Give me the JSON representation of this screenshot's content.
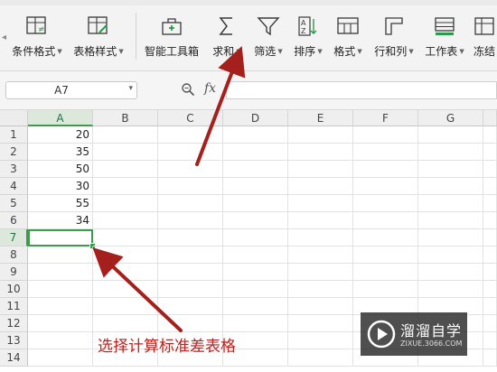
{
  "ribbon": {
    "left_scroll_icon": "chevron-left-icon",
    "buttons": [
      {
        "id": "conditional-format",
        "label": "条件格式",
        "has_dropdown": true,
        "icon": "conditional-format-icon"
      },
      {
        "id": "table-style",
        "label": "表格样式",
        "has_dropdown": true,
        "icon": "table-style-icon"
      },
      {
        "id": "smart-toolbox",
        "label": "智能工具箱",
        "has_dropdown": false,
        "icon": "toolbox-icon"
      },
      {
        "id": "sum",
        "label": "求和",
        "has_dropdown": true,
        "icon": "sigma-icon"
      },
      {
        "id": "filter",
        "label": "筛选",
        "has_dropdown": true,
        "icon": "filter-icon"
      },
      {
        "id": "sort",
        "label": "排序",
        "has_dropdown": true,
        "icon": "sort-az-icon"
      },
      {
        "id": "format",
        "label": "格式",
        "has_dropdown": true,
        "icon": "format-icon"
      },
      {
        "id": "rows-cols",
        "label": "行和列",
        "has_dropdown": true,
        "icon": "rows-cols-icon"
      },
      {
        "id": "worksheet",
        "label": "工作表",
        "has_dropdown": true,
        "icon": "worksheet-icon"
      },
      {
        "id": "freeze",
        "label": "冻结",
        "has_dropdown": false,
        "icon": "freeze-icon"
      }
    ]
  },
  "formula_bar": {
    "name_box": "A7",
    "zoom_icon": "zoom-icon",
    "fx_label": "fx",
    "formula": ""
  },
  "sheet": {
    "columns": [
      "A",
      "B",
      "C",
      "D",
      "E",
      "F",
      "G"
    ],
    "rows": [
      "1",
      "2",
      "3",
      "4",
      "5",
      "6",
      "7",
      "8",
      "9",
      "10",
      "11",
      "12",
      "13",
      "14"
    ],
    "selected_column": "A",
    "selected_row": "7",
    "values_col_a": [
      "20",
      "35",
      "50",
      "30",
      "55",
      "34"
    ],
    "active_cell": "A7"
  },
  "annotation": {
    "text": "选择计算标准差表格",
    "color": "#c0201d"
  },
  "watermark": {
    "brand": "溜溜自学",
    "url": "ZIXUE.3066.COM"
  },
  "colors": {
    "accent_green": "#3d9b4e",
    "annotation_red": "#c0201d"
  }
}
